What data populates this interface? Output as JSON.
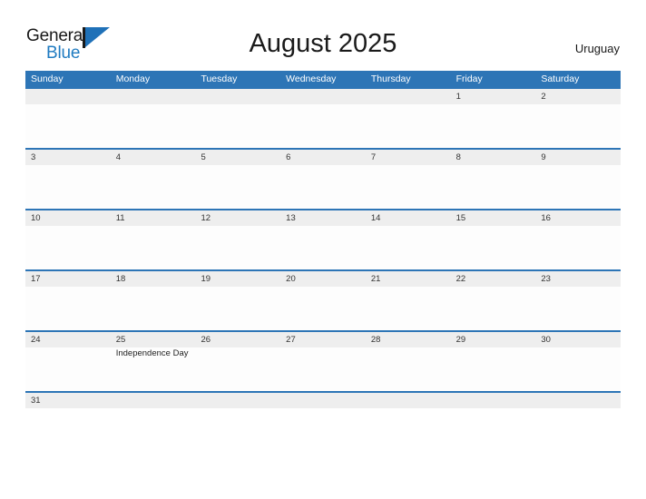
{
  "brand": {
    "name_part1": "General",
    "name_part2": "Blue",
    "flag_icon": "flag-triangle-icon",
    "color_primary": "#1f71b8",
    "color_text": "#1a1a1a"
  },
  "header": {
    "title": "August 2025",
    "location": "Uruguay"
  },
  "colors": {
    "header_band": "#2d75b6",
    "number_band": "#eeeeee",
    "row_divider": "#2d75b6",
    "cell_background": "#fdfdfd",
    "day_number_text": "#333333",
    "day_name_text": "#ffffff"
  },
  "calendar": {
    "day_names": [
      "Sunday",
      "Monday",
      "Tuesday",
      "Wednesday",
      "Thursday",
      "Friday",
      "Saturday"
    ],
    "weeks": [
      {
        "numbers": [
          "",
          "",
          "",
          "",
          "",
          "1",
          "2"
        ],
        "events": [
          "",
          "",
          "",
          "",
          "",
          "",
          ""
        ]
      },
      {
        "numbers": [
          "3",
          "4",
          "5",
          "6",
          "7",
          "8",
          "9"
        ],
        "events": [
          "",
          "",
          "",
          "",
          "",
          "",
          ""
        ]
      },
      {
        "numbers": [
          "10",
          "11",
          "12",
          "13",
          "14",
          "15",
          "16"
        ],
        "events": [
          "",
          "",
          "",
          "",
          "",
          "",
          ""
        ]
      },
      {
        "numbers": [
          "17",
          "18",
          "19",
          "20",
          "21",
          "22",
          "23"
        ],
        "events": [
          "",
          "",
          "",
          "",
          "",
          "",
          ""
        ]
      },
      {
        "numbers": [
          "24",
          "25",
          "26",
          "27",
          "28",
          "29",
          "30"
        ],
        "events": [
          "",
          "Independence Day",
          "",
          "",
          "",
          "",
          ""
        ]
      },
      {
        "numbers": [
          "31",
          "",
          "",
          "",
          "",
          "",
          ""
        ],
        "events": [
          "",
          "",
          "",
          "",
          "",
          "",
          ""
        ]
      }
    ]
  }
}
